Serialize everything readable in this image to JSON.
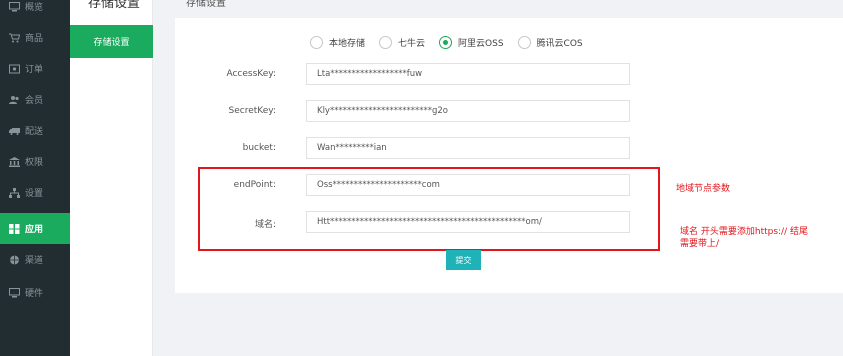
{
  "nav": {
    "items": [
      {
        "label": "概览",
        "icon": "monitor-icon"
      },
      {
        "label": "商品",
        "icon": "cart-icon"
      },
      {
        "label": "订单",
        "icon": "order-icon"
      },
      {
        "label": "会员",
        "icon": "users-icon"
      },
      {
        "label": "配送",
        "icon": "truck-icon"
      },
      {
        "label": "权限",
        "icon": "bank-icon"
      },
      {
        "label": "设置",
        "icon": "sitemap-icon"
      },
      {
        "label": "应用",
        "icon": "apps-icon"
      },
      {
        "label": "渠道",
        "icon": "globe-icon"
      },
      {
        "label": "硬件",
        "icon": "monitor-icon"
      }
    ],
    "active_index": 7
  },
  "subpanel": {
    "title": "存储设置",
    "item": "存储设置"
  },
  "main": {
    "title": "存储设置"
  },
  "storage_options": [
    {
      "label": "本地存储",
      "checked": false
    },
    {
      "label": "七牛云",
      "checked": false
    },
    {
      "label": "阿里云OSS",
      "checked": true
    },
    {
      "label": "腾讯云COS",
      "checked": false
    }
  ],
  "form": {
    "accesskey_label": "AccessKey:",
    "accesskey_value": "Lta******************fuw",
    "secretkey_label": "SecretKey:",
    "secretkey_value": "Kly************************g2o",
    "bucket_label": "bucket:",
    "bucket_value": "Wan*********ian",
    "endpoint_label": "endPoint:",
    "endpoint_value": "Oss*********************com",
    "domain_label": "域名:",
    "domain_value": "Htt**********************************************om/",
    "submit_label": "提交"
  },
  "annotations": {
    "endpoint_note": "地域节点参数",
    "domain_note_line1": "域名 开头需要添加https://  结尾",
    "domain_note_line2": "需要带上/"
  },
  "colors": {
    "nav_bg": "#222d32",
    "accent_green": "#1aab5e",
    "submit_teal": "#1fb3b8",
    "annotation_red": "#e4151b"
  }
}
